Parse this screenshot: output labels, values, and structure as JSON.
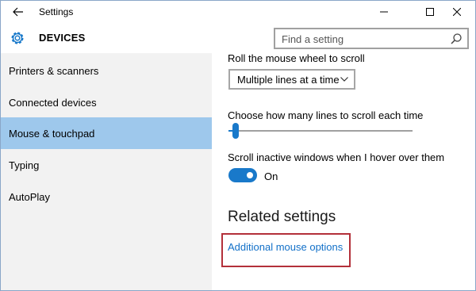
{
  "window": {
    "title": "Settings",
    "controls": [
      "minimize",
      "maximize",
      "close"
    ]
  },
  "header": {
    "title": "DEVICES",
    "icon": "gear-icon",
    "search": {
      "placeholder": "Find a setting",
      "value": ""
    }
  },
  "sidebar": {
    "items": [
      {
        "label": "Printers & scanners",
        "active": false
      },
      {
        "label": "Connected devices",
        "active": false
      },
      {
        "label": "Mouse & touchpad",
        "active": true
      },
      {
        "label": "Typing",
        "active": false
      },
      {
        "label": "AutoPlay",
        "active": false
      }
    ]
  },
  "main": {
    "scroll_label": "Roll the mouse wheel to scroll",
    "scroll_option": "Multiple lines at a time",
    "lines_label": "Choose how many lines to scroll each time",
    "lines_level": 0.03,
    "inactive_label": "Scroll inactive windows when I hover over them",
    "inactive_state": "On",
    "related_title": "Related settings",
    "related_link": "Additional mouse options"
  },
  "colors": {
    "accent": "#1979ca",
    "sidebar_bg": "#f2f2f2",
    "selected_bg": "#9ec8ec",
    "link": "#1270c8",
    "highlight": "#b3303a"
  }
}
